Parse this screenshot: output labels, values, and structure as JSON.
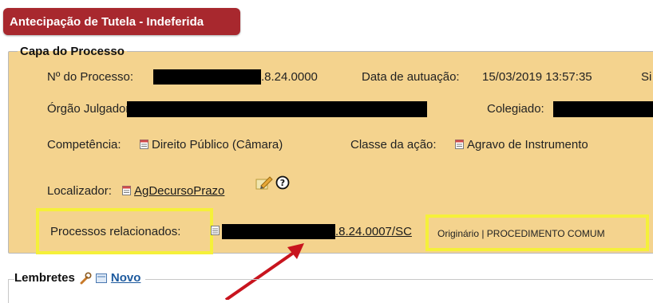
{
  "badge": {
    "label": "Antecipação de Tutela - Indeferida"
  },
  "panel": {
    "legend": "Capa do Processo"
  },
  "rows": {
    "processo_label": "Nº do Processo:",
    "processo_suffix": ".8.24.0000",
    "data_label": "Data de autuação:",
    "data_value": "15/03/2019 13:57:35",
    "cut_label": "Si",
    "orgao_label": "Órgão Julgador:",
    "colegiado_label": "Colegiado:",
    "competencia_label": "Competência:",
    "competencia_value": "Direito Público (Câmara)",
    "classe_label": "Classe da ação:",
    "classe_value": "Agravo de Instrumento",
    "localizador_label": "Localizador:",
    "localizador_value": "AgDecursoPrazo",
    "relacionados_label": "Processos relacionados:",
    "relacionado_suffix": ".8.24.0007/SC",
    "relacionado_info": "Originário  |  PROCEDIMENTO COMUM"
  },
  "lembretes": {
    "label": "Lembretes",
    "novo": "Novo"
  },
  "colors": {
    "badge": "#a8282e",
    "panel": "#f4d38e",
    "highlight": "#f5f03a",
    "arrow": "#c8141e"
  },
  "icons": [
    "doc-icon",
    "wrench-icon",
    "new-note-icon",
    "edit-icon",
    "help-icon",
    "arrow-annotation"
  ]
}
